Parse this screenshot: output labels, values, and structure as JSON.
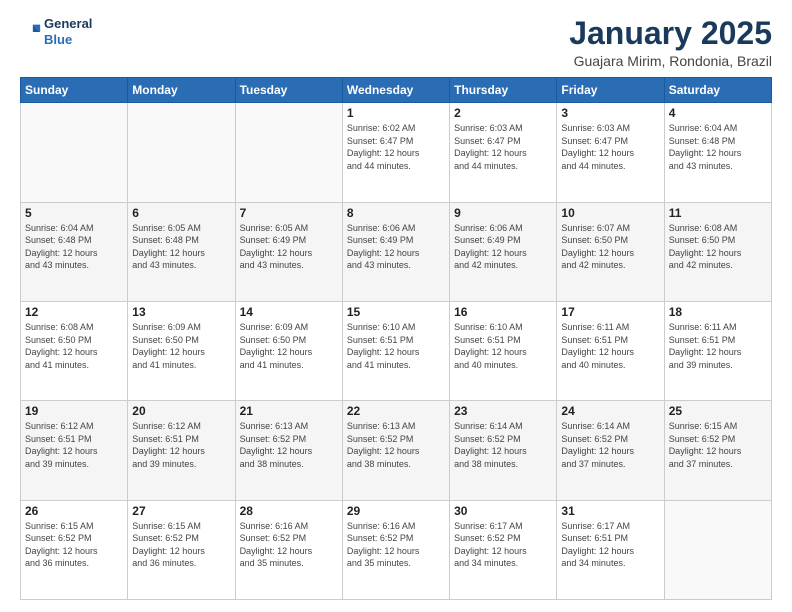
{
  "logo": {
    "line1": "General",
    "line2": "Blue"
  },
  "header": {
    "title": "January 2025",
    "subtitle": "Guajara Mirim, Rondonia, Brazil"
  },
  "weekdays": [
    "Sunday",
    "Monday",
    "Tuesday",
    "Wednesday",
    "Thursday",
    "Friday",
    "Saturday"
  ],
  "weeks": [
    [
      {
        "day": "",
        "info": ""
      },
      {
        "day": "",
        "info": ""
      },
      {
        "day": "",
        "info": ""
      },
      {
        "day": "1",
        "info": "Sunrise: 6:02 AM\nSunset: 6:47 PM\nDaylight: 12 hours\nand 44 minutes."
      },
      {
        "day": "2",
        "info": "Sunrise: 6:03 AM\nSunset: 6:47 PM\nDaylight: 12 hours\nand 44 minutes."
      },
      {
        "day": "3",
        "info": "Sunrise: 6:03 AM\nSunset: 6:47 PM\nDaylight: 12 hours\nand 44 minutes."
      },
      {
        "day": "4",
        "info": "Sunrise: 6:04 AM\nSunset: 6:48 PM\nDaylight: 12 hours\nand 43 minutes."
      }
    ],
    [
      {
        "day": "5",
        "info": "Sunrise: 6:04 AM\nSunset: 6:48 PM\nDaylight: 12 hours\nand 43 minutes."
      },
      {
        "day": "6",
        "info": "Sunrise: 6:05 AM\nSunset: 6:48 PM\nDaylight: 12 hours\nand 43 minutes."
      },
      {
        "day": "7",
        "info": "Sunrise: 6:05 AM\nSunset: 6:49 PM\nDaylight: 12 hours\nand 43 minutes."
      },
      {
        "day": "8",
        "info": "Sunrise: 6:06 AM\nSunset: 6:49 PM\nDaylight: 12 hours\nand 43 minutes."
      },
      {
        "day": "9",
        "info": "Sunrise: 6:06 AM\nSunset: 6:49 PM\nDaylight: 12 hours\nand 42 minutes."
      },
      {
        "day": "10",
        "info": "Sunrise: 6:07 AM\nSunset: 6:50 PM\nDaylight: 12 hours\nand 42 minutes."
      },
      {
        "day": "11",
        "info": "Sunrise: 6:08 AM\nSunset: 6:50 PM\nDaylight: 12 hours\nand 42 minutes."
      }
    ],
    [
      {
        "day": "12",
        "info": "Sunrise: 6:08 AM\nSunset: 6:50 PM\nDaylight: 12 hours\nand 41 minutes."
      },
      {
        "day": "13",
        "info": "Sunrise: 6:09 AM\nSunset: 6:50 PM\nDaylight: 12 hours\nand 41 minutes."
      },
      {
        "day": "14",
        "info": "Sunrise: 6:09 AM\nSunset: 6:50 PM\nDaylight: 12 hours\nand 41 minutes."
      },
      {
        "day": "15",
        "info": "Sunrise: 6:10 AM\nSunset: 6:51 PM\nDaylight: 12 hours\nand 41 minutes."
      },
      {
        "day": "16",
        "info": "Sunrise: 6:10 AM\nSunset: 6:51 PM\nDaylight: 12 hours\nand 40 minutes."
      },
      {
        "day": "17",
        "info": "Sunrise: 6:11 AM\nSunset: 6:51 PM\nDaylight: 12 hours\nand 40 minutes."
      },
      {
        "day": "18",
        "info": "Sunrise: 6:11 AM\nSunset: 6:51 PM\nDaylight: 12 hours\nand 39 minutes."
      }
    ],
    [
      {
        "day": "19",
        "info": "Sunrise: 6:12 AM\nSunset: 6:51 PM\nDaylight: 12 hours\nand 39 minutes."
      },
      {
        "day": "20",
        "info": "Sunrise: 6:12 AM\nSunset: 6:51 PM\nDaylight: 12 hours\nand 39 minutes."
      },
      {
        "day": "21",
        "info": "Sunrise: 6:13 AM\nSunset: 6:52 PM\nDaylight: 12 hours\nand 38 minutes."
      },
      {
        "day": "22",
        "info": "Sunrise: 6:13 AM\nSunset: 6:52 PM\nDaylight: 12 hours\nand 38 minutes."
      },
      {
        "day": "23",
        "info": "Sunrise: 6:14 AM\nSunset: 6:52 PM\nDaylight: 12 hours\nand 38 minutes."
      },
      {
        "day": "24",
        "info": "Sunrise: 6:14 AM\nSunset: 6:52 PM\nDaylight: 12 hours\nand 37 minutes."
      },
      {
        "day": "25",
        "info": "Sunrise: 6:15 AM\nSunset: 6:52 PM\nDaylight: 12 hours\nand 37 minutes."
      }
    ],
    [
      {
        "day": "26",
        "info": "Sunrise: 6:15 AM\nSunset: 6:52 PM\nDaylight: 12 hours\nand 36 minutes."
      },
      {
        "day": "27",
        "info": "Sunrise: 6:15 AM\nSunset: 6:52 PM\nDaylight: 12 hours\nand 36 minutes."
      },
      {
        "day": "28",
        "info": "Sunrise: 6:16 AM\nSunset: 6:52 PM\nDaylight: 12 hours\nand 35 minutes."
      },
      {
        "day": "29",
        "info": "Sunrise: 6:16 AM\nSunset: 6:52 PM\nDaylight: 12 hours\nand 35 minutes."
      },
      {
        "day": "30",
        "info": "Sunrise: 6:17 AM\nSunset: 6:52 PM\nDaylight: 12 hours\nand 34 minutes."
      },
      {
        "day": "31",
        "info": "Sunrise: 6:17 AM\nSunset: 6:51 PM\nDaylight: 12 hours\nand 34 minutes."
      },
      {
        "day": "",
        "info": ""
      }
    ]
  ]
}
